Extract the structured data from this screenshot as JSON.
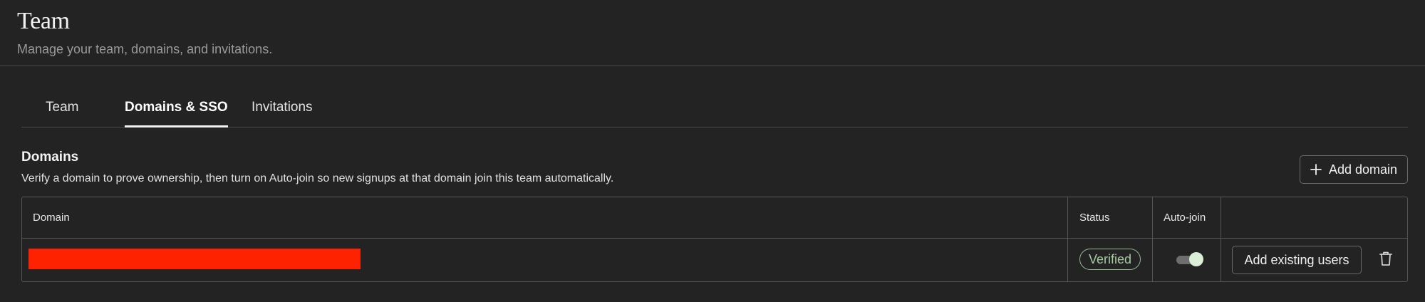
{
  "header": {
    "title": "Team",
    "subtitle": "Manage your team, domains, and invitations."
  },
  "tabs": [
    {
      "label": "Team",
      "active": false
    },
    {
      "label": "Domains & SSO",
      "active": true
    },
    {
      "label": "Invitations",
      "active": false
    }
  ],
  "domains": {
    "title": "Domains",
    "description": "Verify a domain to prove ownership, then turn on Auto-join so new signups at that domain join this team automatically.",
    "add_button_label": "Add domain",
    "columns": {
      "domain": "Domain",
      "status": "Status",
      "auto_join": "Auto-join"
    },
    "rows": [
      {
        "domain_redacted": true,
        "status": "Verified",
        "auto_join": true,
        "action_label": "Add existing users"
      }
    ]
  },
  "icons": {
    "add": "plus-icon",
    "delete": "trash-icon"
  },
  "colors": {
    "background": "#232323",
    "verified": "#a6c9a2",
    "toggle_knob": "#dbeed6",
    "redaction": "#ff2200"
  }
}
